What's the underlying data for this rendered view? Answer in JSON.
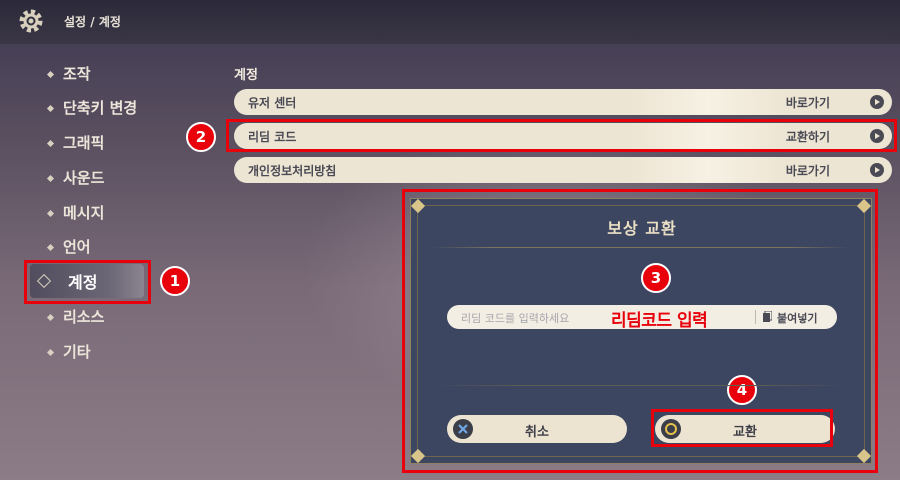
{
  "header": {
    "breadcrumb": "설정 / 계정"
  },
  "sidebar": {
    "items": [
      {
        "label": "조작"
      },
      {
        "label": "단축키 변경"
      },
      {
        "label": "그래픽"
      },
      {
        "label": "사운드"
      },
      {
        "label": "메시지"
      },
      {
        "label": "언어"
      },
      {
        "label": "계정",
        "active": true
      },
      {
        "label": "리소스"
      },
      {
        "label": "기타"
      }
    ]
  },
  "main": {
    "section_title": "계정",
    "rows": [
      {
        "label": "유저 센터",
        "action": "바로가기"
      },
      {
        "label": "리딤 코드",
        "action": "교환하기"
      },
      {
        "label": "개인정보처리방침",
        "action": "바로가기"
      }
    ]
  },
  "dialog": {
    "title": "보상 교환",
    "input_placeholder": "리딤 코드를 입력하세요",
    "annotation": "리딤코드 입력",
    "paste_label": "붙여넣기",
    "cancel_label": "취소",
    "confirm_label": "교환"
  },
  "steps": [
    "1",
    "2",
    "3",
    "4"
  ],
  "colors": {
    "highlight": "#e8000b",
    "dialog_bg": "#3c4661",
    "row_bg": "#ede5d3"
  }
}
